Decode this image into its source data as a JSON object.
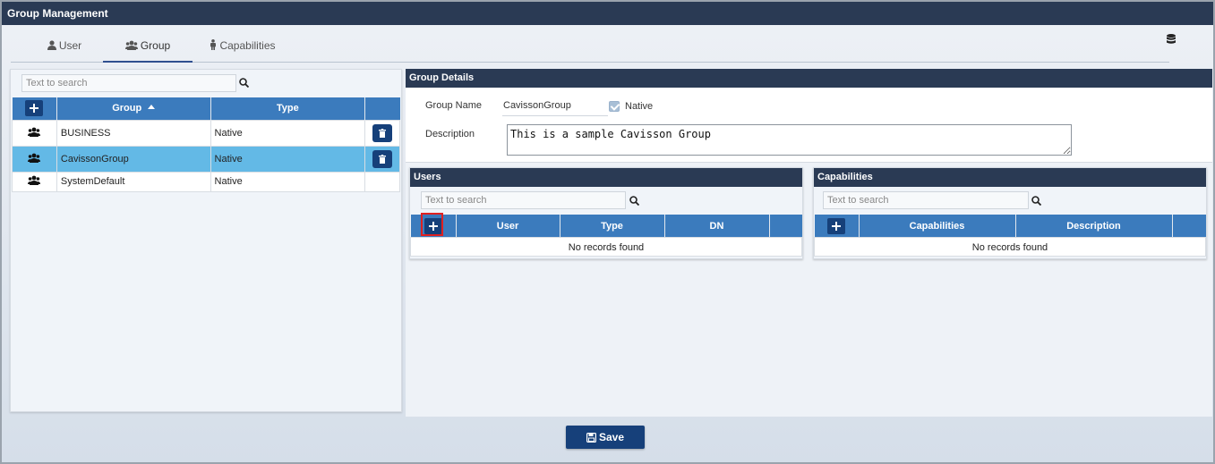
{
  "window": {
    "title": "Group Management"
  },
  "tabs": [
    {
      "label": "User",
      "icon": "user-icon",
      "active": false
    },
    {
      "label": "Group",
      "icon": "users-icon",
      "active": true
    },
    {
      "label": "Capabilities",
      "icon": "person-icon",
      "active": false
    }
  ],
  "groups_panel": {
    "search_placeholder": "Text to search",
    "columns": [
      "Group",
      "Type"
    ],
    "sort_indicator": "ascending",
    "rows": [
      {
        "name": "BUSINESS",
        "type": "Native",
        "deletable": true,
        "selected": false
      },
      {
        "name": "CavissonGroup",
        "type": "Native",
        "deletable": true,
        "selected": true
      },
      {
        "name": "SystemDefault",
        "type": "Native",
        "deletable": false,
        "selected": false
      }
    ]
  },
  "group_details": {
    "title": "Group Details",
    "group_name_label": "Group Name",
    "group_name_value": "CavissonGroup",
    "native_label": "Native",
    "native_checked": true,
    "description_label": "Description",
    "description_value": "This is a sample Cavisson Group"
  },
  "users_panel": {
    "title": "Users",
    "search_placeholder": "Text to search",
    "columns": [
      "User",
      "Type",
      "DN"
    ],
    "empty_text": "No records found"
  },
  "capabilities_panel": {
    "title": "Capabilities",
    "search_placeholder": "Text to search",
    "columns": [
      "Capabilities",
      "Description"
    ],
    "empty_text": "No records found"
  },
  "footer": {
    "save_label": "Save"
  },
  "colors": {
    "header_dark": "#2a3a54",
    "table_header": "#3b7bbd",
    "selected_row": "#63b9e6",
    "button_navy": "#16407a",
    "highlight": "#e02020"
  }
}
